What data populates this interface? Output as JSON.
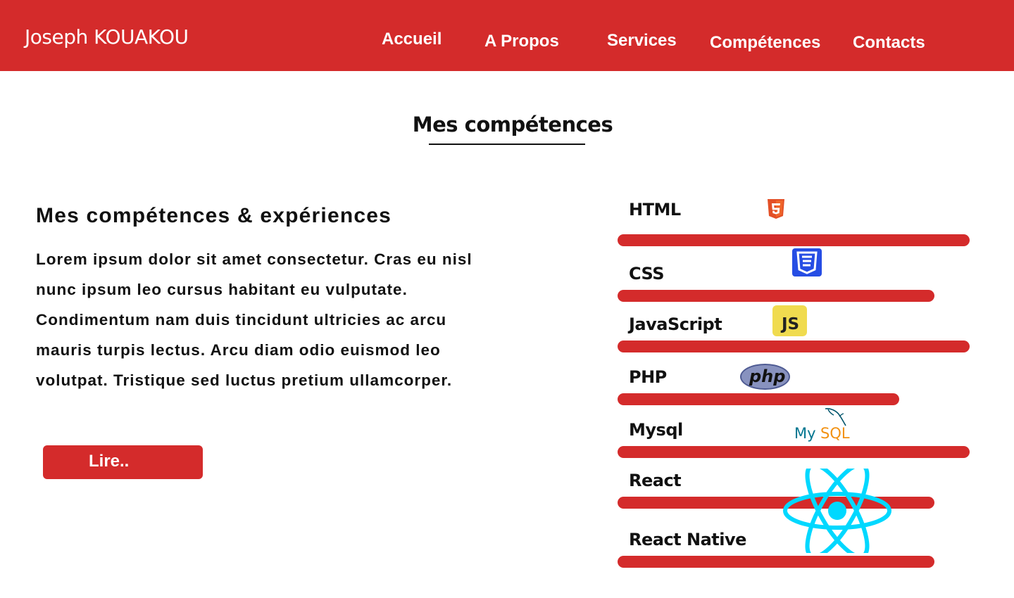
{
  "header": {
    "brand": "Joseph KOUAKOU",
    "nav": [
      {
        "label": "Accueil"
      },
      {
        "label": "A Propos"
      },
      {
        "label": "Services"
      },
      {
        "label": "Compétences"
      },
      {
        "label": "Contacts"
      }
    ]
  },
  "section": {
    "title": "Mes compétences"
  },
  "intro": {
    "heading": "Mes compétences & expériences",
    "paragraph": "Lorem ipsum dolor sit amet consectetur. Cras eu nisl nunc ipsum leo cursus habitant eu vulputate. Condimentum nam duis tincidunt ultricies ac arcu mauris turpis lectus. Arcu diam odio euismod leo volutpat. Tristique sed luctus pretium ullamcorper.",
    "button_label": "Lire.."
  },
  "skills": [
    {
      "name": "HTML",
      "level_pct": 100,
      "icon": "html5-icon",
      "icon_color": "#e34f26"
    },
    {
      "name": "CSS",
      "level_pct": 90,
      "icon": "css3-icon",
      "icon_color": "#264de4"
    },
    {
      "name": "JavaScript",
      "level_pct": 100,
      "icon": "javascript-icon",
      "icon_color": "#f0db4f"
    },
    {
      "name": "PHP",
      "level_pct": 80,
      "icon": "php-icon",
      "icon_color": "#8892bf"
    },
    {
      "name": "Mysql",
      "level_pct": 100,
      "icon": "mysql-icon",
      "icon_color": "#00758f"
    },
    {
      "name": "React",
      "level_pct": 90,
      "icon": "react-icon",
      "icon_color": "#00d8ff"
    },
    {
      "name": "React Native",
      "level_pct": 90,
      "icon": "react-native-icon",
      "icon_color": "#00d8ff"
    }
  ],
  "icon_text": {
    "js": "JS",
    "php": "php",
    "mysql_my": "My",
    "mysql_sql": "SQL"
  },
  "colors": {
    "accent": "#d42b2b",
    "text": "#111111",
    "background": "#ffffff"
  }
}
